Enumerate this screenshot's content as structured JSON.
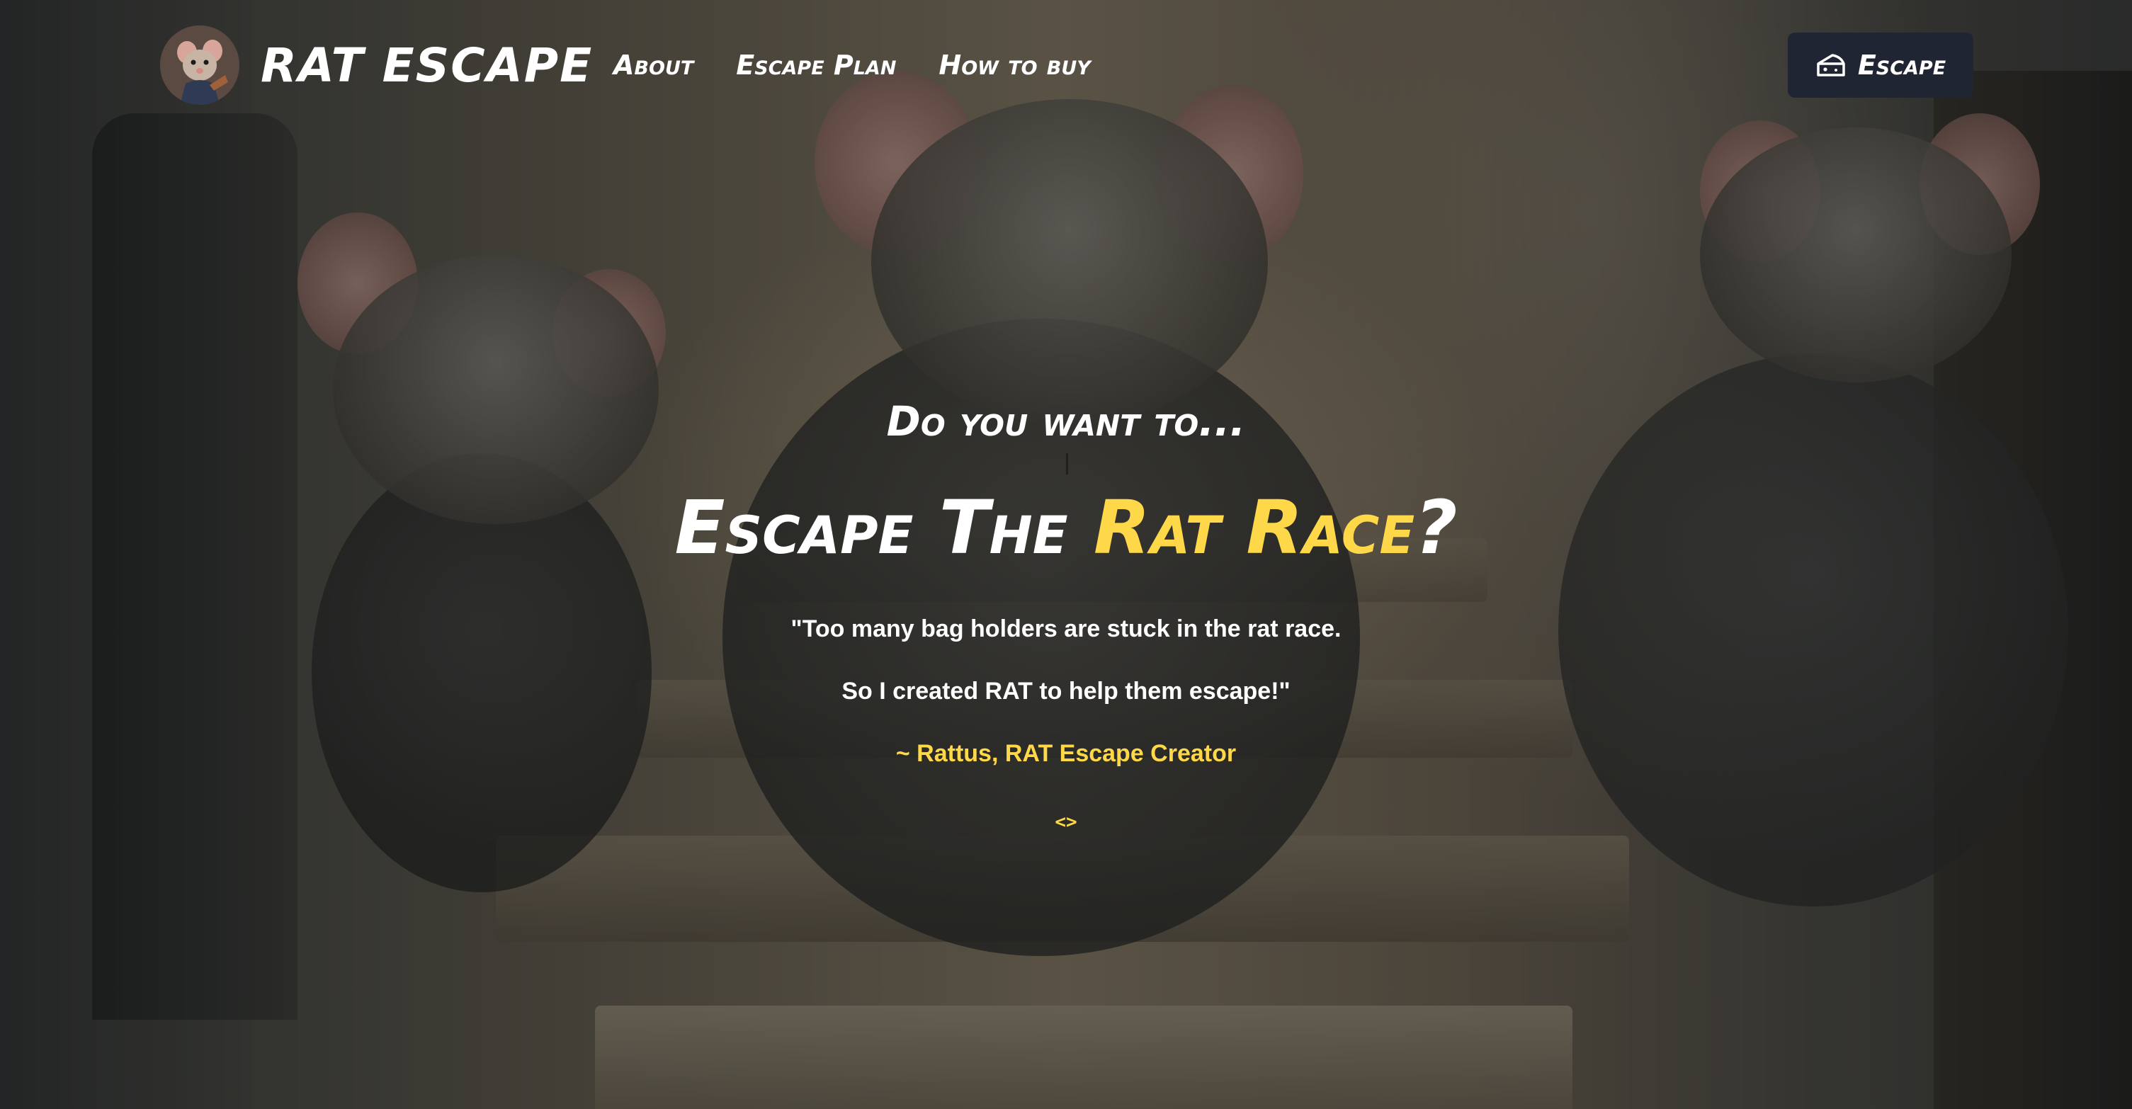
{
  "header": {
    "brand": "RAT ESCAPE",
    "nav": [
      {
        "label": "About"
      },
      {
        "label": "Escape Plan"
      },
      {
        "label": "How to buy"
      }
    ],
    "escape_button": {
      "label": "Escape",
      "icon": "cheese-icon"
    }
  },
  "hero": {
    "pretitle": "Do you want to...",
    "headline_part1": "Escape The ",
    "headline_accent": "Rat Race",
    "headline_part2": "?",
    "quote_line1": "\"Too many bag holders are stuck in the rat race.",
    "quote_line2": "So I created RAT to help them escape!\"",
    "attribution": "~ Rattus, RAT Escape Creator",
    "carousel_control": "<>"
  },
  "colors": {
    "accent": "#ffd84a",
    "button_bg": "#1f2533",
    "text": "#ffffff"
  }
}
